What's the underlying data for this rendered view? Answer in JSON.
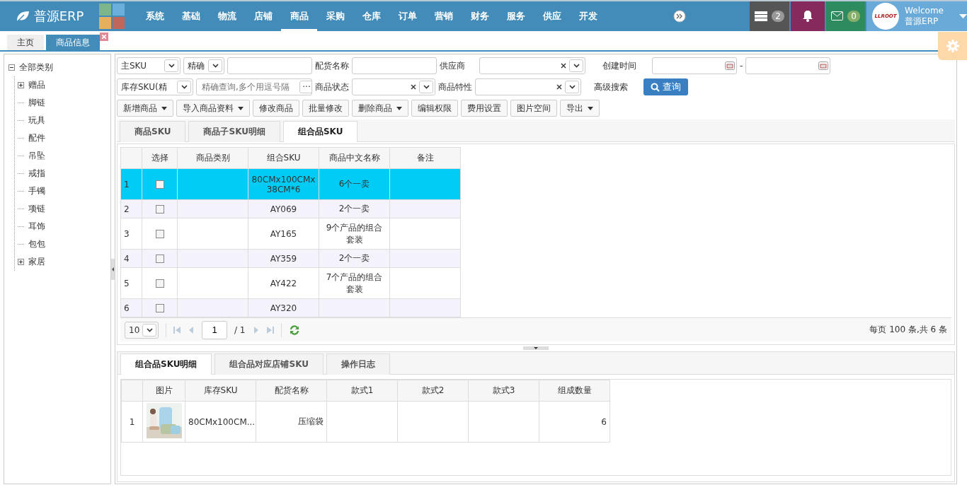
{
  "header": {
    "logo": "普源ERP",
    "nav": [
      {
        "label": "系统",
        "selected": false
      },
      {
        "label": "基础",
        "selected": false
      },
      {
        "label": "物流",
        "selected": false
      },
      {
        "label": "店铺",
        "selected": false
      },
      {
        "label": "商品",
        "selected": true
      },
      {
        "label": "采购",
        "selected": false
      },
      {
        "label": "仓库",
        "selected": false
      },
      {
        "label": "订单",
        "selected": false
      },
      {
        "label": "营销",
        "selected": false
      },
      {
        "label": "财务",
        "selected": false
      },
      {
        "label": "服务",
        "selected": false
      },
      {
        "label": "供应",
        "selected": false
      },
      {
        "label": "开发",
        "selected": false
      }
    ],
    "tasks_count": "2",
    "messages_count": "0",
    "avatar_logo": "LLROOT",
    "welcome": "Welcome",
    "user": "普源ERP"
  },
  "page_tabs": [
    {
      "label": "主页",
      "selected": false,
      "closable": false
    },
    {
      "label": "商品信息",
      "selected": true,
      "closable": true
    }
  ],
  "tree": {
    "label": "全部类别",
    "expanded": true,
    "has_children": true,
    "children": [
      {
        "label": "赠品",
        "expanded": false,
        "has_children": true
      },
      {
        "label": "脚链",
        "has_children": false
      },
      {
        "label": "玩具",
        "has_children": false
      },
      {
        "label": "配件",
        "has_children": false
      },
      {
        "label": "吊坠",
        "has_children": false
      },
      {
        "label": "戒指",
        "has_children": false
      },
      {
        "label": "手镯",
        "has_children": false
      },
      {
        "label": "项链",
        "has_children": false
      },
      {
        "label": "耳饰",
        "has_children": false
      },
      {
        "label": "包包",
        "has_children": false
      },
      {
        "label": "家居",
        "expanded": false,
        "has_children": true
      }
    ]
  },
  "filters": {
    "sku_type": "主SKU",
    "match": "精确",
    "pick_name_label": "配货名称",
    "supplier_label": "供应商",
    "created_label": "创建时间",
    "date_separator": "-",
    "stock_sku_type": "库存SKU(精",
    "stock_sku_placeholder": "精确查询,多个用逗号隔",
    "more_button": "···",
    "status_label": "商品状态",
    "feature_label": "商品特性",
    "advanced_link": "高级搜索",
    "search_button": "查询"
  },
  "toolbar": [
    {
      "label": "新增商品",
      "dropdown": true
    },
    {
      "label": "导入商品资料",
      "dropdown": true
    },
    {
      "label": "修改商品",
      "dropdown": false
    },
    {
      "label": "批量修改",
      "dropdown": false
    },
    {
      "label": "删除商品",
      "dropdown": true
    },
    {
      "label": "编辑权限",
      "dropdown": false
    },
    {
      "label": "费用设置",
      "dropdown": false
    },
    {
      "label": "图片空间",
      "dropdown": false
    },
    {
      "label": "导出",
      "dropdown": true
    }
  ],
  "tabs": [
    {
      "label": "商品SKU",
      "selected": false
    },
    {
      "label": "商品子SKU明细",
      "selected": false
    },
    {
      "label": "组合品SKU",
      "selected": true
    }
  ],
  "table": {
    "columns": [
      "选择",
      "商品类别",
      "组合SKU",
      "商品中文名称",
      "备注"
    ],
    "rows": [
      {
        "num": "1",
        "checked": false,
        "selected": true,
        "category": "",
        "sku": "80CMx100CMx 38CM*6",
        "name": "6个一卖",
        "note": ""
      },
      {
        "num": "2",
        "checked": false,
        "selected": false,
        "category": "",
        "sku": "AY069",
        "name": "2个一卖",
        "note": ""
      },
      {
        "num": "3",
        "checked": false,
        "selected": false,
        "category": "",
        "sku": "AY165",
        "name": "9个产品的组合套装",
        "note": ""
      },
      {
        "num": "4",
        "checked": false,
        "selected": false,
        "category": "",
        "sku": "AY359",
        "name": "2个一卖",
        "note": ""
      },
      {
        "num": "5",
        "checked": false,
        "selected": false,
        "category": "",
        "sku": "AY422",
        "name": "7个产品的组合套装",
        "note": ""
      },
      {
        "num": "6",
        "checked": false,
        "selected": false,
        "category": "",
        "sku": "AY320",
        "name": "",
        "note": ""
      }
    ]
  },
  "pager": {
    "page_size": "10",
    "page": "1",
    "total_pages": "/ 1",
    "summary": "每页 100 条,共 6 条"
  },
  "detail_tabs": [
    {
      "label": "组合品SKU明细",
      "selected": true
    },
    {
      "label": "组合品对应店铺SKU",
      "selected": false
    },
    {
      "label": "操作日志",
      "selected": false
    }
  ],
  "detail_table": {
    "columns": [
      "图片",
      "库存SKU",
      "配货名称",
      "款式1",
      "款式2",
      "款式3",
      "组成数量"
    ],
    "rows": [
      {
        "num": "1",
        "stock_sku": "80CMx100CM...",
        "pick_name": "压缩袋",
        "style1": "",
        "style2": "",
        "style3": "",
        "quantity": "6"
      }
    ]
  }
}
